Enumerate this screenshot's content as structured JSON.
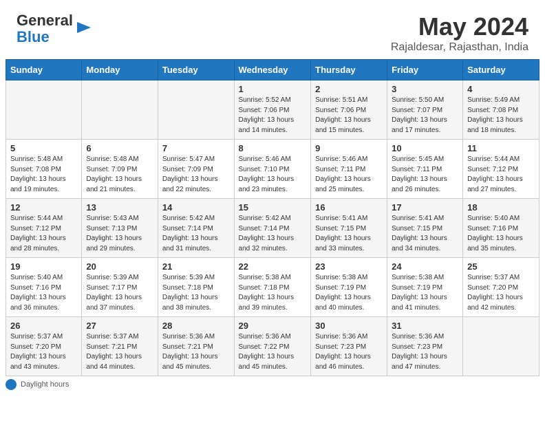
{
  "header": {
    "logo_line1": "General",
    "logo_line2": "Blue",
    "month_year": "May 2024",
    "location": "Rajaldesar, Rajasthan, India"
  },
  "days_of_week": [
    "Sunday",
    "Monday",
    "Tuesday",
    "Wednesday",
    "Thursday",
    "Friday",
    "Saturday"
  ],
  "weeks": [
    [
      {
        "day": "",
        "info": ""
      },
      {
        "day": "",
        "info": ""
      },
      {
        "day": "",
        "info": ""
      },
      {
        "day": "1",
        "info": "Sunrise: 5:52 AM\nSunset: 7:06 PM\nDaylight: 13 hours and 14 minutes."
      },
      {
        "day": "2",
        "info": "Sunrise: 5:51 AM\nSunset: 7:06 PM\nDaylight: 13 hours and 15 minutes."
      },
      {
        "day": "3",
        "info": "Sunrise: 5:50 AM\nSunset: 7:07 PM\nDaylight: 13 hours and 17 minutes."
      },
      {
        "day": "4",
        "info": "Sunrise: 5:49 AM\nSunset: 7:08 PM\nDaylight: 13 hours and 18 minutes."
      }
    ],
    [
      {
        "day": "5",
        "info": "Sunrise: 5:48 AM\nSunset: 7:08 PM\nDaylight: 13 hours and 19 minutes."
      },
      {
        "day": "6",
        "info": "Sunrise: 5:48 AM\nSunset: 7:09 PM\nDaylight: 13 hours and 21 minutes."
      },
      {
        "day": "7",
        "info": "Sunrise: 5:47 AM\nSunset: 7:09 PM\nDaylight: 13 hours and 22 minutes."
      },
      {
        "day": "8",
        "info": "Sunrise: 5:46 AM\nSunset: 7:10 PM\nDaylight: 13 hours and 23 minutes."
      },
      {
        "day": "9",
        "info": "Sunrise: 5:46 AM\nSunset: 7:11 PM\nDaylight: 13 hours and 25 minutes."
      },
      {
        "day": "10",
        "info": "Sunrise: 5:45 AM\nSunset: 7:11 PM\nDaylight: 13 hours and 26 minutes."
      },
      {
        "day": "11",
        "info": "Sunrise: 5:44 AM\nSunset: 7:12 PM\nDaylight: 13 hours and 27 minutes."
      }
    ],
    [
      {
        "day": "12",
        "info": "Sunrise: 5:44 AM\nSunset: 7:12 PM\nDaylight: 13 hours and 28 minutes."
      },
      {
        "day": "13",
        "info": "Sunrise: 5:43 AM\nSunset: 7:13 PM\nDaylight: 13 hours and 29 minutes."
      },
      {
        "day": "14",
        "info": "Sunrise: 5:42 AM\nSunset: 7:14 PM\nDaylight: 13 hours and 31 minutes."
      },
      {
        "day": "15",
        "info": "Sunrise: 5:42 AM\nSunset: 7:14 PM\nDaylight: 13 hours and 32 minutes."
      },
      {
        "day": "16",
        "info": "Sunrise: 5:41 AM\nSunset: 7:15 PM\nDaylight: 13 hours and 33 minutes."
      },
      {
        "day": "17",
        "info": "Sunrise: 5:41 AM\nSunset: 7:15 PM\nDaylight: 13 hours and 34 minutes."
      },
      {
        "day": "18",
        "info": "Sunrise: 5:40 AM\nSunset: 7:16 PM\nDaylight: 13 hours and 35 minutes."
      }
    ],
    [
      {
        "day": "19",
        "info": "Sunrise: 5:40 AM\nSunset: 7:16 PM\nDaylight: 13 hours and 36 minutes."
      },
      {
        "day": "20",
        "info": "Sunrise: 5:39 AM\nSunset: 7:17 PM\nDaylight: 13 hours and 37 minutes."
      },
      {
        "day": "21",
        "info": "Sunrise: 5:39 AM\nSunset: 7:18 PM\nDaylight: 13 hours and 38 minutes."
      },
      {
        "day": "22",
        "info": "Sunrise: 5:38 AM\nSunset: 7:18 PM\nDaylight: 13 hours and 39 minutes."
      },
      {
        "day": "23",
        "info": "Sunrise: 5:38 AM\nSunset: 7:19 PM\nDaylight: 13 hours and 40 minutes."
      },
      {
        "day": "24",
        "info": "Sunrise: 5:38 AM\nSunset: 7:19 PM\nDaylight: 13 hours and 41 minutes."
      },
      {
        "day": "25",
        "info": "Sunrise: 5:37 AM\nSunset: 7:20 PM\nDaylight: 13 hours and 42 minutes."
      }
    ],
    [
      {
        "day": "26",
        "info": "Sunrise: 5:37 AM\nSunset: 7:20 PM\nDaylight: 13 hours and 43 minutes."
      },
      {
        "day": "27",
        "info": "Sunrise: 5:37 AM\nSunset: 7:21 PM\nDaylight: 13 hours and 44 minutes."
      },
      {
        "day": "28",
        "info": "Sunrise: 5:36 AM\nSunset: 7:21 PM\nDaylight: 13 hours and 45 minutes."
      },
      {
        "day": "29",
        "info": "Sunrise: 5:36 AM\nSunset: 7:22 PM\nDaylight: 13 hours and 45 minutes."
      },
      {
        "day": "30",
        "info": "Sunrise: 5:36 AM\nSunset: 7:23 PM\nDaylight: 13 hours and 46 minutes."
      },
      {
        "day": "31",
        "info": "Sunrise: 5:36 AM\nSunset: 7:23 PM\nDaylight: 13 hours and 47 minutes."
      },
      {
        "day": "",
        "info": ""
      }
    ]
  ],
  "footer": {
    "daylight_label": "Daylight hours"
  }
}
